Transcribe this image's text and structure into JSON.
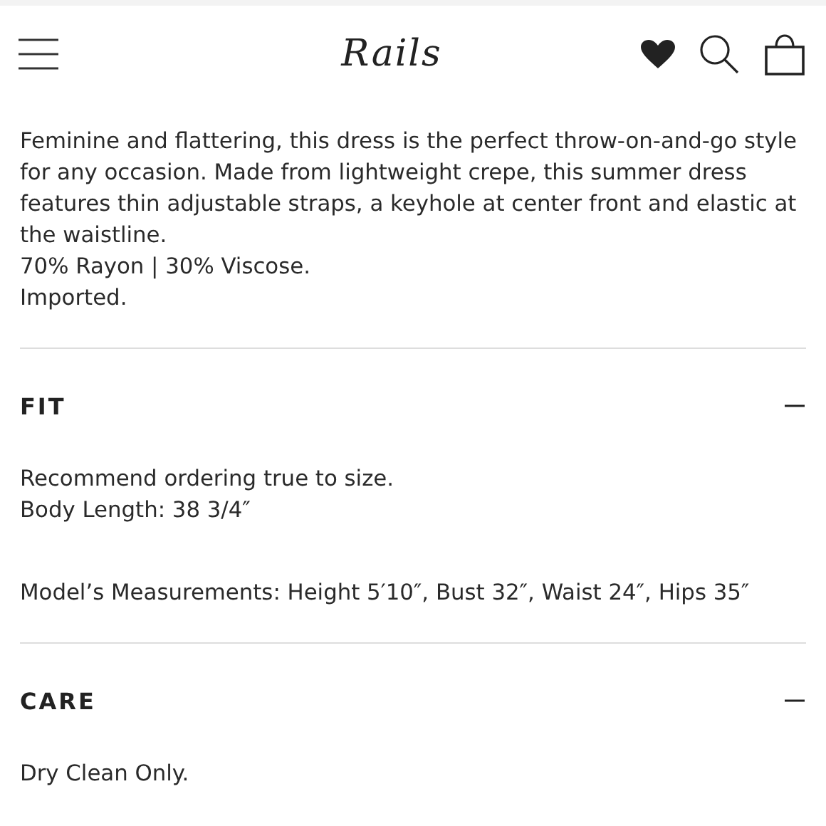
{
  "header": {
    "logo": "Rails"
  },
  "description": [
    "Feminine and flattering, this dress is the perfect throw-on-and-go style for any occasion. Made from lightweight crepe, this summer dress features thin adjustable straps, a keyhole at center front and elastic at the waistline.",
    "70% Rayon | 30% Viscose.",
    "Imported."
  ],
  "sections": [
    {
      "title": "FIT",
      "expanded": true,
      "blocks": [
        [
          "Recommend ordering true to size.",
          "Body Length: 38 3/4″"
        ],
        [
          "Model’s Measurements: Height 5′10″, Bust 32″, Waist 24″, Hips 35″"
        ]
      ]
    },
    {
      "title": "CARE",
      "expanded": true,
      "blocks": [
        [
          "Dry Clean Only."
        ]
      ]
    }
  ]
}
